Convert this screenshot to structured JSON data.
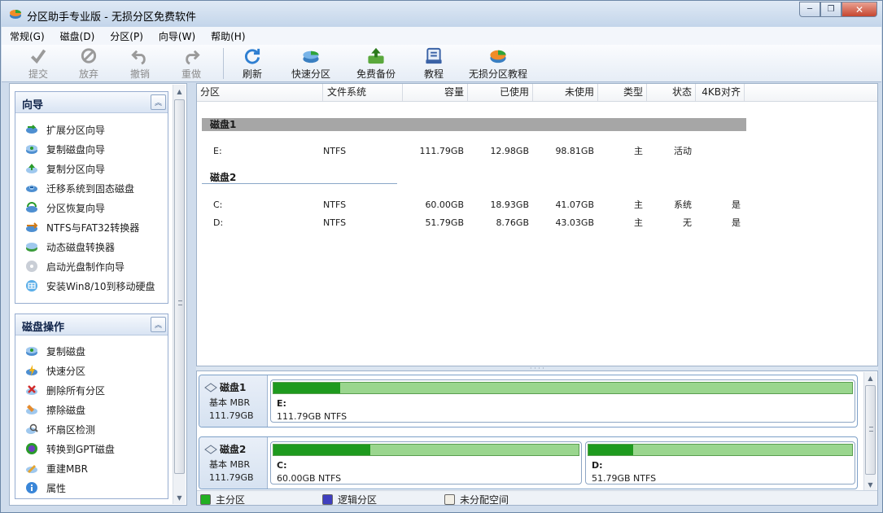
{
  "window": {
    "title": "分区助手专业版 - 无损分区免费软件",
    "minimize": "─",
    "restore": "❐",
    "close": "✕"
  },
  "menu": [
    "常规(G)",
    "磁盘(D)",
    "分区(P)",
    "向导(W)",
    "帮助(H)"
  ],
  "toolbar": [
    {
      "label": "提交",
      "icon": "check-icon",
      "disabled": true
    },
    {
      "label": "放弃",
      "icon": "discard-icon",
      "disabled": true
    },
    {
      "label": "撤销",
      "icon": "undo-icon",
      "disabled": true
    },
    {
      "label": "重做",
      "icon": "redo-icon",
      "disabled": true
    },
    {
      "label": "刷新",
      "icon": "refresh-icon",
      "disabled": false
    },
    {
      "label": "快速分区",
      "icon": "quick-partition-icon",
      "disabled": false
    },
    {
      "label": "免费备份",
      "icon": "backup-icon",
      "disabled": false
    },
    {
      "label": "教程",
      "icon": "tutorial-icon",
      "disabled": false
    },
    {
      "label": "无损分区教程",
      "icon": "lossless-tutorial-icon",
      "disabled": false
    }
  ],
  "wizard_group": {
    "title": "向导",
    "collapse": "︽",
    "items": [
      "扩展分区向导",
      "复制磁盘向导",
      "复制分区向导",
      "迁移系统到固态磁盘",
      "分区恢复向导",
      "NTFS与FAT32转换器",
      "动态磁盘转换器",
      "启动光盘制作向导",
      "安装Win8/10到移动硬盘"
    ]
  },
  "disk_ops_group": {
    "title": "磁盘操作",
    "collapse": "︽",
    "items": [
      "复制磁盘",
      "快速分区",
      "删除所有分区",
      "擦除磁盘",
      "坏扇区检测",
      "转换到GPT磁盘",
      "重建MBR",
      "属性"
    ]
  },
  "scroll": {
    "up": "▲",
    "down": "▼"
  },
  "table": {
    "columns": [
      "分区",
      "文件系统",
      "容量",
      "已使用",
      "未使用",
      "类型",
      "状态",
      "4KB对齐"
    ],
    "disks": [
      {
        "name": "磁盘1",
        "rows": [
          {
            "partition": "E:",
            "fs": "NTFS",
            "capacity": "111.79GB",
            "used": "12.98GB",
            "free": "98.81GB",
            "type": "主",
            "status": "活动",
            "align": ""
          }
        ]
      },
      {
        "name": "磁盘2",
        "rows": [
          {
            "partition": "C:",
            "fs": "NTFS",
            "capacity": "60.00GB",
            "used": "18.93GB",
            "free": "41.07GB",
            "type": "主",
            "status": "系统",
            "align": "是"
          },
          {
            "partition": "D:",
            "fs": "NTFS",
            "capacity": "51.79GB",
            "used": "8.76GB",
            "free": "43.03GB",
            "type": "主",
            "status": "无",
            "align": "是"
          }
        ]
      }
    ]
  },
  "diskmap": [
    {
      "name": "磁盘1",
      "type": "基本 MBR",
      "size": "111.79GB",
      "partitions": [
        {
          "letter": "E:",
          "info": "111.79GB NTFS",
          "used_fraction": 0.116
        }
      ]
    },
    {
      "name": "磁盘2",
      "type": "基本 MBR",
      "size": "111.79GB",
      "partitions": [
        {
          "letter": "C:",
          "info": "60.00GB NTFS",
          "used_fraction": 0.316
        },
        {
          "letter": "D:",
          "info": "51.79GB NTFS",
          "used_fraction": 0.169
        }
      ]
    }
  ],
  "legend": [
    {
      "label": "主分区",
      "color": "#22b022"
    },
    {
      "label": "逻辑分区",
      "color": "#3f3fbf"
    },
    {
      "label": "未分配空间",
      "color": "#f2efe6"
    }
  ],
  "colors": {
    "used_fill": "#1e9a1e",
    "free_fill": "#9ad68e"
  }
}
